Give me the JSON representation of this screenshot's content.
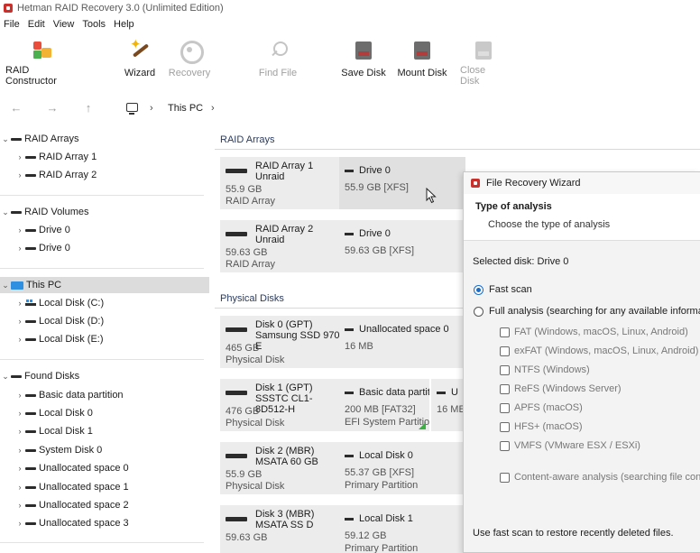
{
  "window": {
    "title": "Hetman RAID Recovery 3.0 (Unlimited Edition)"
  },
  "menu": [
    "File",
    "Edit",
    "View",
    "Tools",
    "Help"
  ],
  "toolbar": {
    "raid_constructor": "RAID Constructor",
    "wizard": "Wizard",
    "recovery": "Recovery",
    "find_file": "Find File",
    "save_disk": "Save Disk",
    "mount_disk": "Mount Disk",
    "close_disk": "Close Disk"
  },
  "address": {
    "crumb": "This PC"
  },
  "tree": {
    "raid_arrays": {
      "label": "RAID Arrays",
      "items": [
        "RAID Array 1",
        "RAID Array 2"
      ]
    },
    "raid_volumes": {
      "label": "RAID Volumes",
      "items": [
        "Drive 0",
        "Drive 0"
      ]
    },
    "this_pc": {
      "label": "This PC",
      "items": [
        "Local Disk (C:)",
        "Local Disk (D:)",
        "Local Disk (E:)"
      ]
    },
    "found_disks": {
      "label": "Found Disks",
      "items": [
        "Basic data partition",
        "Local Disk 0",
        "Local Disk 1",
        "System Disk 0",
        "Unallocated space 0",
        "Unallocated space 1",
        "Unallocated space 2",
        "Unallocated space 3"
      ]
    }
  },
  "content": {
    "raid_arrays_header": "RAID Arrays",
    "physical_disks_header": "Physical Disks",
    "raid_cards": [
      {
        "title1": "RAID Array 1",
        "title2": "Unraid",
        "size": "55.9 GB",
        "type": "RAID Array",
        "part_name": "Drive 0",
        "part_info": "55.9 GB [XFS]"
      },
      {
        "title1": "RAID Array 2",
        "title2": "Unraid",
        "size": "59.63 GB",
        "type": "RAID Array",
        "part_name": "Drive 0",
        "part_info": "59.63 GB [XFS]"
      }
    ],
    "disks": [
      {
        "title1": "Disk 0 (GPT)",
        "title2": "Samsung SSD 970 E",
        "size": "465 GB",
        "type": "Physical Disk",
        "part_name": "Unallocated space 0",
        "part_info": "16 MB",
        "part_info2": ""
      },
      {
        "title1": "Disk 1 (GPT)",
        "title2": "SSSTC CL1-8D512-H",
        "size": "476 GB",
        "type": "Physical Disk",
        "part_name": "Basic data partit",
        "part_info": "200 MB [FAT32]",
        "part_info2": "EFI System Partitio",
        "part2_name": "U",
        "part2_info": "16 ME"
      },
      {
        "title1": "Disk 2 (MBR)",
        "title2": "MSATA 60 GB",
        "size": "55.9 GB",
        "type": "Physical Disk",
        "part_name": "Local Disk 0",
        "part_info": "55.37 GB [XFS]",
        "part_info2": "Primary Partition"
      },
      {
        "title1": "Disk 3 (MBR)",
        "title2": "MSATA SS D",
        "size": "59.63 GB",
        "type": "Physical Disk",
        "part_name": "Local Disk 1",
        "part_info": "59.12 GB",
        "part_info2": "Primary Partition"
      }
    ]
  },
  "wizard": {
    "title": "File Recovery Wizard",
    "heading": "Type of analysis",
    "subheading": "Choose the type of analysis",
    "selected_disk": "Selected disk: Drive 0",
    "fast_scan": "Fast scan",
    "full_analysis": "Full analysis (searching for any available information)",
    "filesystems": [
      "FAT (Windows, macOS, Linux, Android)",
      "exFAT (Windows, macOS, Linux, Android)",
      "NTFS (Windows)",
      "ReFS (Windows Server)",
      "APFS (macOS)",
      "HFS+ (macOS)",
      "VMFS (VMware ESX / ESXi)"
    ],
    "content_aware": "Content-aware analysis (searching file contents)",
    "hint": "Use fast scan to restore recently deleted files."
  },
  "colors": {
    "accent": "#1a6cc6",
    "selected_bg": "#dcdcdc",
    "header_text": "#2a3b5f",
    "this_pc_icon": "#2f8fe0"
  }
}
